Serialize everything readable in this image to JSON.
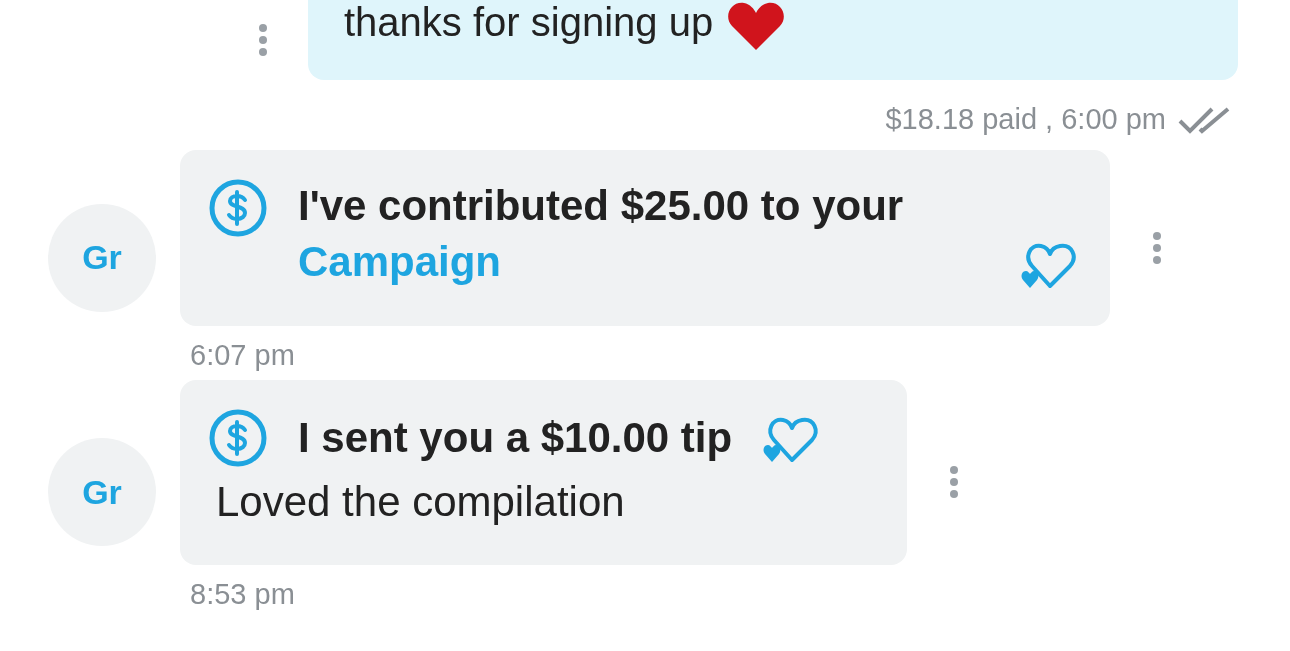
{
  "outgoing": {
    "text": "thanks for signing up",
    "meta": "$18.18 paid , 6:00 pm"
  },
  "incoming": [
    {
      "avatar": "Gr",
      "kind": "campaign",
      "title": "I've contributed $25.00 to your",
      "link": "Campaign",
      "time": "6:07 pm"
    },
    {
      "avatar": "Gr",
      "kind": "tip",
      "title": "I sent you a $10.00 tip",
      "body": "Loved the compilation",
      "time": "8:53 pm"
    }
  ]
}
